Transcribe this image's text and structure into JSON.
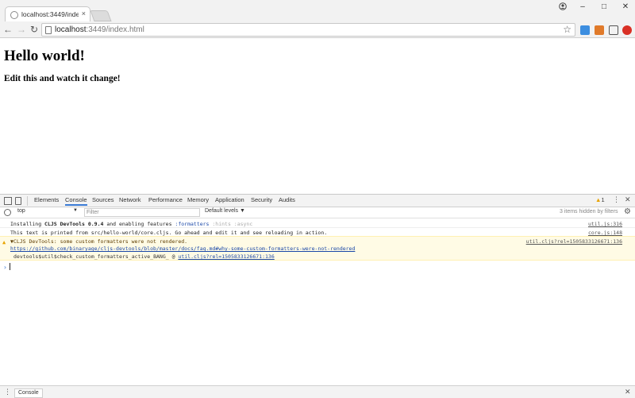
{
  "browser": {
    "tab_title": "localhost:3449/index.ht",
    "tab_close": "×",
    "window_controls": {
      "minimize": "–",
      "maximize": "□",
      "close": "✕"
    },
    "nav": {
      "back": "←",
      "forward": "→",
      "reload": "↻"
    },
    "url_host": "localhost",
    "url_path": ":3449/index.html",
    "bookmark_star": "☆"
  },
  "page": {
    "heading": "Hello world!",
    "subheading": "Edit this and watch it change!"
  },
  "devtools": {
    "tabs": [
      "Elements",
      "Console",
      "Sources",
      "Network",
      "Performance",
      "Memory",
      "Application",
      "Security",
      "Audits"
    ],
    "active_tab": "Console",
    "warning_count": "1",
    "menu_glyph": "⋮",
    "close_glyph": "✕",
    "context": "top",
    "filter_placeholder": "Filter",
    "levels": "Default levels ▼",
    "hidden_count": "3 items hidden by filters",
    "messages": {
      "m1": {
        "text_a": "Installing ",
        "text_b": "CLJS DevTools 0.9.4",
        "text_c": " and enabling features ",
        "feature1": ":formatters",
        "feature2": " :hints :async",
        "source": "util.js:316"
      },
      "m2": {
        "text": "This text is printed from src/hello-world/core.cljs. Go ahead and edit it and see reloading in action.",
        "source": "core.js:148"
      },
      "m3": {
        "line1": "▼CLJS DevTools: some custom formatters were not rendered.",
        "line2": "https://github.com/binaryage/cljs-devtools/blob/master/docs/faq.md#why-some-custom-formatters-were-not-rendered",
        "line3_a": "devtools$util$check_custom_formatters_active_BANG_ @ ",
        "line3_link": "util.cljs?rel=1505833126671:136",
        "source": "util.cljs?rel=1505833126671:136"
      }
    },
    "prompt": "›",
    "drawer_tab": "Console",
    "drawer_menu": "⋮"
  }
}
